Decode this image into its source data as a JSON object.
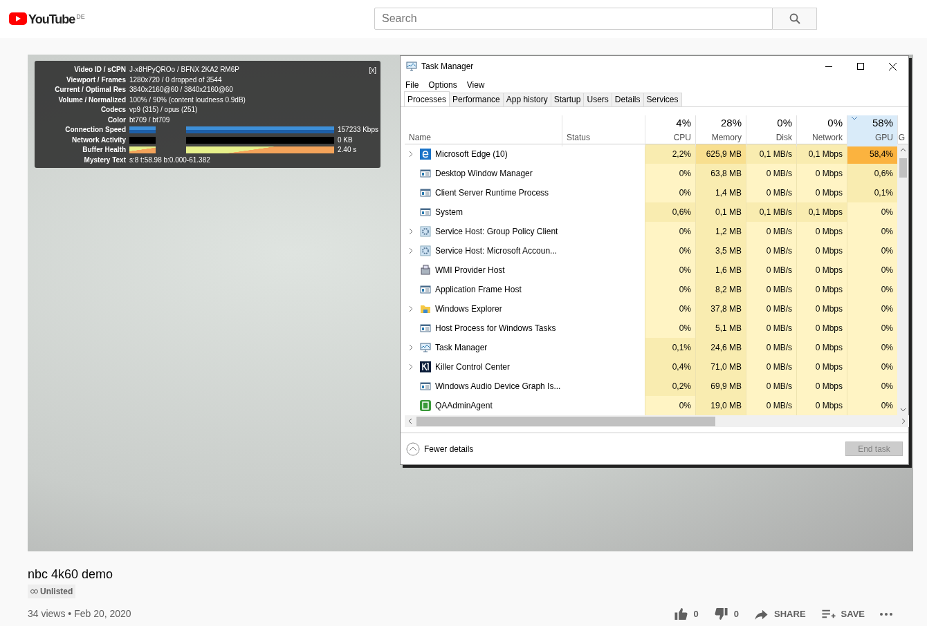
{
  "header": {
    "logo_text": "YouTube",
    "region": "DE",
    "search": {
      "placeholder": "Search"
    }
  },
  "stats": {
    "close": "[x]",
    "rows": [
      {
        "label": "Video ID / sCPN",
        "value": "J-x8HPyQROo / BFNX 2KA2 RM6P"
      },
      {
        "label": "Viewport / Frames",
        "value": "1280x720 / 0 dropped of 3544"
      },
      {
        "label": "Current / Optimal Res",
        "value": "3840x2160@60 / 3840x2160@60"
      },
      {
        "label": "Volume / Normalized",
        "value": "100% / 90% (content loudness 0.9dB)"
      },
      {
        "label": "Codecs",
        "value": "vp9 (315) / opus (251)"
      },
      {
        "label": "Color",
        "value": "bt709 / bt709"
      }
    ],
    "graphs": [
      {
        "label": "Connection Speed",
        "kind": "speed",
        "reading": "157233 Kbps"
      },
      {
        "label": "Network Activity",
        "kind": "activity",
        "reading": "0 KB"
      },
      {
        "label": "Buffer Health",
        "kind": "buffer",
        "reading": "2.40 s"
      }
    ],
    "mystery": {
      "label": "Mystery Text",
      "value": "s:8 t:58.98 b:0.000-61.382"
    }
  },
  "task_manager": {
    "title": "Task Manager",
    "menu": [
      "File",
      "Options",
      "View"
    ],
    "tabs": [
      {
        "label": "Processes",
        "selected": true
      },
      {
        "label": "Performance",
        "selected": false
      },
      {
        "label": "App history",
        "selected": false
      },
      {
        "label": "Startup",
        "selected": false
      },
      {
        "label": "Users",
        "selected": false
      },
      {
        "label": "Details",
        "selected": false
      },
      {
        "label": "Services",
        "selected": false
      }
    ],
    "columns": [
      {
        "label": "Name",
        "sorted": false
      },
      {
        "label": "Status",
        "sorted": false
      },
      {
        "label": "CPU",
        "total": "4%",
        "sorted": false
      },
      {
        "label": "Memory",
        "total": "28%",
        "sorted": false
      },
      {
        "label": "Disk",
        "total": "0%",
        "sorted": false
      },
      {
        "label": "Network",
        "total": "0%",
        "sorted": false
      },
      {
        "label": "GPU",
        "total": "58%",
        "sorted": true
      },
      {
        "label": "G",
        "sorted": false
      }
    ],
    "rows": [
      {
        "kind": "browser",
        "expandable": true,
        "cells": [
          {
            "t": "Microsoft Edge (10)"
          },
          null,
          {
            "t": "2,2%",
            "color": "#f9ecb0"
          },
          {
            "t": "625,9 MB",
            "color": "#f8df8f"
          },
          {
            "t": "0,1 MB/s",
            "color": "#f9ecb0"
          },
          {
            "t": "0,1 Mbps",
            "color": "#f9ecb0"
          },
          {
            "t": "58,4%",
            "color": "#fbb33f"
          }
        ]
      },
      {
        "kind": "window",
        "expandable": false,
        "cells": [
          {
            "t": "Desktop Window Manager"
          },
          null,
          {
            "t": "0%",
            "color": "#fff4c4"
          },
          {
            "t": "63,8 MB",
            "color": "#f9ecb0"
          },
          {
            "t": "0 MB/s",
            "color": "#fff4c4"
          },
          {
            "t": "0 Mbps",
            "color": "#fff4c4"
          },
          {
            "t": "0,6%",
            "color": "#f9ecb0"
          }
        ]
      },
      {
        "kind": "window",
        "expandable": false,
        "cells": [
          {
            "t": "Client Server Runtime Process"
          },
          null,
          {
            "t": "0%",
            "color": "#fff4c4"
          },
          {
            "t": "1,4 MB",
            "color": "#f9ecb0"
          },
          {
            "t": "0 MB/s",
            "color": "#fff4c4"
          },
          {
            "t": "0 Mbps",
            "color": "#fff4c4"
          },
          {
            "t": "0,1%",
            "color": "#f9ecb0"
          }
        ]
      },
      {
        "kind": "window",
        "expandable": false,
        "cells": [
          {
            "t": "System"
          },
          null,
          {
            "t": "0,6%",
            "color": "#f9ecb0"
          },
          {
            "t": "0,1 MB",
            "color": "#f9ecb0"
          },
          {
            "t": "0,1 MB/s",
            "color": "#f9ecb0"
          },
          {
            "t": "0,1 Mbps",
            "color": "#f9ecb0"
          },
          {
            "t": "0%",
            "color": "#fff4c4"
          }
        ]
      },
      {
        "kind": "service",
        "expandable": true,
        "cells": [
          {
            "t": "Service Host: Group Policy Client"
          },
          null,
          {
            "t": "0%",
            "color": "#fff4c4"
          },
          {
            "t": "1,2 MB",
            "color": "#f9ecb0"
          },
          {
            "t": "0 MB/s",
            "color": "#fff4c4"
          },
          {
            "t": "0 Mbps",
            "color": "#fff4c4"
          },
          {
            "t": "0%",
            "color": "#fff4c4"
          }
        ]
      },
      {
        "kind": "service",
        "expandable": true,
        "cells": [
          {
            "t": "Service Host: Microsoft Accoun..."
          },
          null,
          {
            "t": "0%",
            "color": "#fff4c4"
          },
          {
            "t": "3,5 MB",
            "color": "#f9ecb0"
          },
          {
            "t": "0 MB/s",
            "color": "#fff4c4"
          },
          {
            "t": "0 Mbps",
            "color": "#fff4c4"
          },
          {
            "t": "0%",
            "color": "#fff4c4"
          }
        ]
      },
      {
        "kind": "computer",
        "expandable": false,
        "cells": [
          {
            "t": "WMI Provider Host"
          },
          null,
          {
            "t": "0%",
            "color": "#fff4c4"
          },
          {
            "t": "1,6 MB",
            "color": "#f9ecb0"
          },
          {
            "t": "0 MB/s",
            "color": "#fff4c4"
          },
          {
            "t": "0 Mbps",
            "color": "#fff4c4"
          },
          {
            "t": "0%",
            "color": "#fff4c4"
          }
        ]
      },
      {
        "kind": "window",
        "expandable": false,
        "cells": [
          {
            "t": "Application Frame Host"
          },
          null,
          {
            "t": "0%",
            "color": "#fff4c4"
          },
          {
            "t": "8,2 MB",
            "color": "#f9ecb0"
          },
          {
            "t": "0 MB/s",
            "color": "#fff4c4"
          },
          {
            "t": "0 Mbps",
            "color": "#fff4c4"
          },
          {
            "t": "0%",
            "color": "#fff4c4"
          }
        ]
      },
      {
        "kind": "folder",
        "expandable": true,
        "cells": [
          {
            "t": "Windows Explorer"
          },
          null,
          {
            "t": "0%",
            "color": "#fff4c4"
          },
          {
            "t": "37,8 MB",
            "color": "#f9ecb0"
          },
          {
            "t": "0 MB/s",
            "color": "#fff4c4"
          },
          {
            "t": "0 Mbps",
            "color": "#fff4c4"
          },
          {
            "t": "0%",
            "color": "#fff4c4"
          }
        ]
      },
      {
        "kind": "window",
        "expandable": false,
        "cells": [
          {
            "t": "Host Process for Windows Tasks"
          },
          null,
          {
            "t": "0%",
            "color": "#fff4c4"
          },
          {
            "t": "5,1 MB",
            "color": "#f9ecb0"
          },
          {
            "t": "0 MB/s",
            "color": "#fff4c4"
          },
          {
            "t": "0 Mbps",
            "color": "#fff4c4"
          },
          {
            "t": "0%",
            "color": "#fff4c4"
          }
        ]
      },
      {
        "kind": "monitor",
        "expandable": true,
        "cells": [
          {
            "t": "Task Manager"
          },
          null,
          {
            "t": "0,1%",
            "color": "#f9ecb0"
          },
          {
            "t": "24,6 MB",
            "color": "#f9ecb0"
          },
          {
            "t": "0 MB/s",
            "color": "#fff4c4"
          },
          {
            "t": "0 Mbps",
            "color": "#fff4c4"
          },
          {
            "t": "0%",
            "color": "#fff4c4"
          }
        ]
      },
      {
        "kind": "logo",
        "expandable": true,
        "cells": [
          {
            "t": "Killer Control Center"
          },
          null,
          {
            "t": "0,4%",
            "color": "#f9ecb0"
          },
          {
            "t": "71,0 MB",
            "color": "#f9ecb0"
          },
          {
            "t": "0 MB/s",
            "color": "#fff4c4"
          },
          {
            "t": "0 Mbps",
            "color": "#fff4c4"
          },
          {
            "t": "0%",
            "color": "#fff4c4"
          }
        ]
      },
      {
        "kind": "window",
        "expandable": false,
        "cells": [
          {
            "t": "Windows Audio Device Graph Is..."
          },
          null,
          {
            "t": "0,2%",
            "color": "#f9ecb0"
          },
          {
            "t": "69,9 MB",
            "color": "#f9ecb0"
          },
          {
            "t": "0 MB/s",
            "color": "#fff4c4"
          },
          {
            "t": "0 Mbps",
            "color": "#fff4c4"
          },
          {
            "t": "0%",
            "color": "#fff4c4"
          }
        ]
      },
      {
        "kind": "app",
        "expandable": false,
        "cells": [
          {
            "t": "QAAdminAgent"
          },
          null,
          {
            "t": "0%",
            "color": "#fff4c4"
          },
          {
            "t": "19,0 MB",
            "color": "#f9ecb0"
          },
          {
            "t": "0 MB/s",
            "color": "#fff4c4"
          },
          {
            "t": "0 Mbps",
            "color": "#fff4c4"
          },
          {
            "t": "0%",
            "color": "#fff4c4"
          }
        ]
      }
    ],
    "fewer_details": "Fewer details",
    "end_task": {
      "label": "End task",
      "disabled": true
    }
  },
  "video": {
    "title": "nbc 4k60 demo",
    "privacy": "Unlisted",
    "stats_line": "34 views • Feb 20, 2020",
    "actions": [
      {
        "kind": "like",
        "label": "0"
      },
      {
        "kind": "dislike",
        "label": "0"
      },
      {
        "kind": "share",
        "label": "SHARE"
      },
      {
        "kind": "save",
        "label": "SAVE"
      },
      {
        "kind": "more"
      }
    ]
  }
}
